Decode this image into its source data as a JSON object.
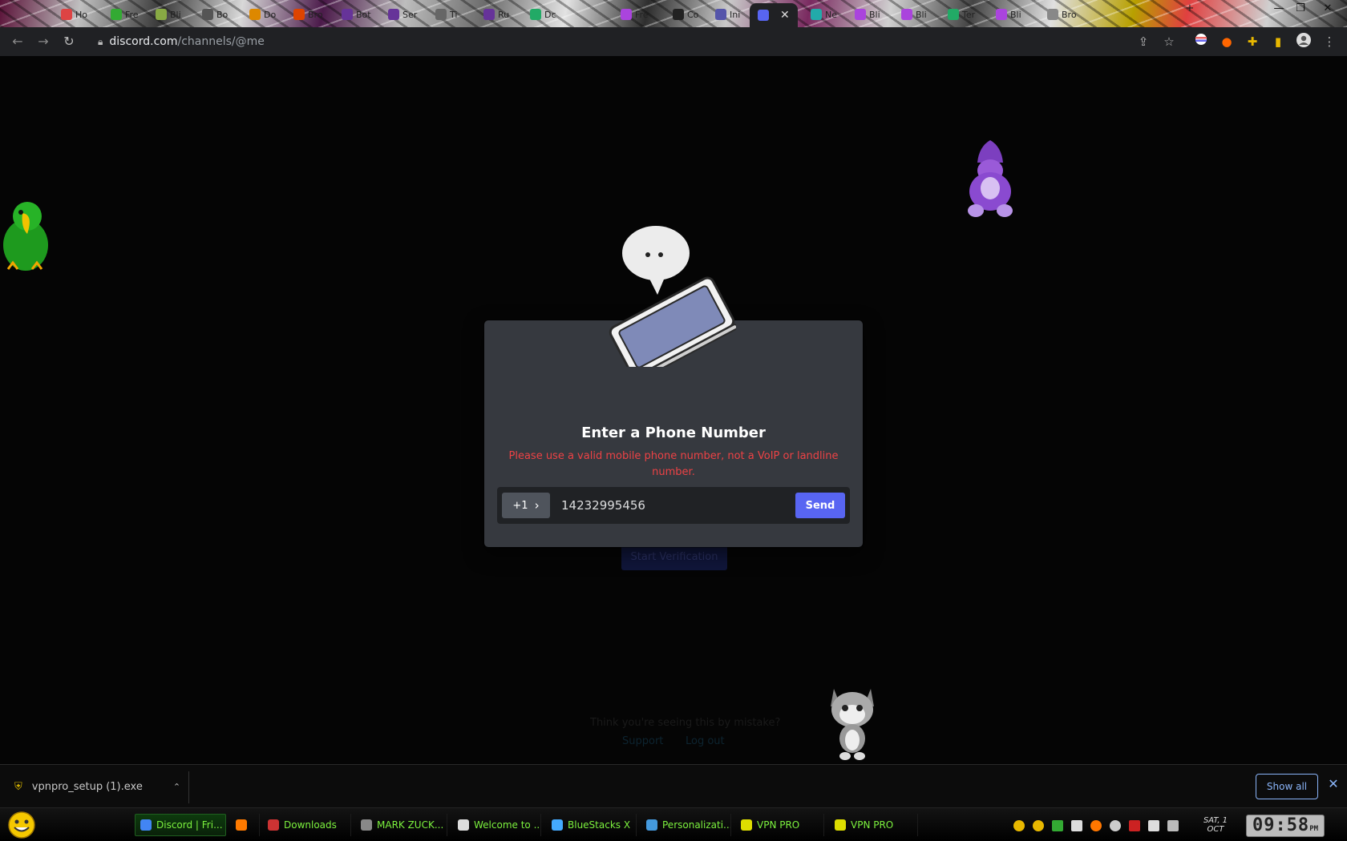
{
  "browser": {
    "tabs": [
      {
        "label": "Ho",
        "color": "#d44"
      },
      {
        "label": "Fre",
        "color": "#3a3"
      },
      {
        "label": "Bli",
        "color": "#8a4"
      },
      {
        "label": "Bo",
        "color": "#555"
      },
      {
        "label": "Do",
        "color": "#d80"
      },
      {
        "label": "Bro",
        "color": "#d40"
      },
      {
        "label": "Bot",
        "color": "#639"
      },
      {
        "label": "Ser",
        "color": "#639"
      },
      {
        "label": "Ti",
        "color": "#666"
      },
      {
        "label": "Ru",
        "color": "#639"
      },
      {
        "label": "Dc",
        "color": "#2a6"
      },
      {
        "label": "Fre",
        "color": "#a4d"
      },
      {
        "label": "Co",
        "color": "#222"
      },
      {
        "label": "Ini",
        "color": "#55a"
      }
    ],
    "active_tab": {
      "close": "✕"
    },
    "tabs_right": [
      {
        "label": "Ne",
        "color": "#2aa"
      },
      {
        "label": "Bli",
        "color": "#a4d"
      },
      {
        "label": "Bli",
        "color": "#a4d"
      },
      {
        "label": "Ter",
        "color": "#2a6"
      },
      {
        "label": "Bli",
        "color": "#a4d"
      },
      {
        "label": "Bro",
        "color": "#888"
      }
    ],
    "window_controls": [
      "—",
      "❐",
      "✕"
    ],
    "new_tab": "+",
    "url_host": "discord.com",
    "url_path": "/channels/@me",
    "nav": {
      "back": "←",
      "forward": "→",
      "reload": "↻"
    }
  },
  "modal": {
    "title": "Enter a Phone Number",
    "error": "Please use a valid mobile phone number, not a VoIP or landline number.",
    "country_code": "+1",
    "country_chevron": "›",
    "phone_value": "14232995456",
    "send_label": "Send"
  },
  "background": {
    "verify_button": "Start Verification",
    "mistake_text": "Think you're seeing this by mistake?",
    "link_support": "Support",
    "link_logout": "Log out"
  },
  "download": {
    "filename": "vpnpro_setup (1).exe",
    "chevron": "⌃",
    "show_all": "Show all",
    "close": "✕"
  },
  "taskbar": {
    "items": [
      {
        "label": "Discord | Fri...",
        "color": "#4285f4"
      },
      {
        "label": "",
        "color": "#ff7a00"
      },
      {
        "label": "Downloads",
        "color": "#c33"
      },
      {
        "label": "MARK ZUCK...",
        "color": "#888"
      },
      {
        "label": "Welcome to ...",
        "color": "#ddd"
      },
      {
        "label": "BlueStacks X",
        "color": "#4af"
      },
      {
        "label": "Personalizati...",
        "color": "#49d"
      },
      {
        "label": "VPN PRO",
        "color": "#dd0"
      },
      {
        "label": "VPN PRO",
        "color": "#dd0"
      }
    ],
    "date_day": "SAT, 1",
    "date_month": "OCT",
    "clock_time": "09:58",
    "clock_ampm": "PM"
  }
}
